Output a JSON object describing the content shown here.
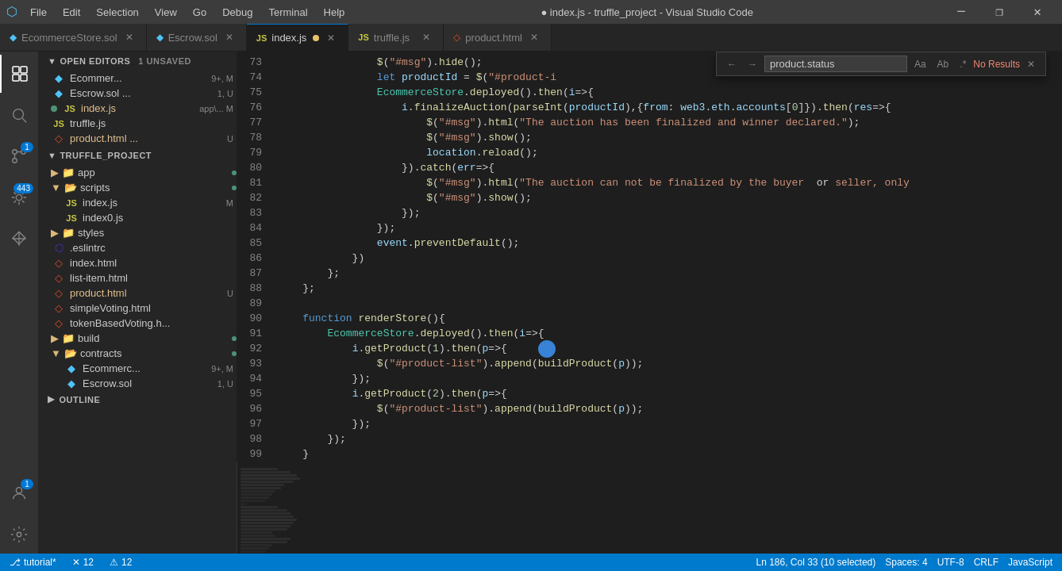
{
  "titleBar": {
    "icon": "⬡",
    "menuItems": [
      "File",
      "Edit",
      "Selection",
      "View",
      "Go",
      "Debug",
      "Terminal",
      "Help"
    ],
    "title": "● index.js - truffle_project - Visual Studio Code",
    "windowControls": {
      "minimize": "─",
      "maximize": "❐",
      "close": "✕"
    }
  },
  "tabs": [
    {
      "id": "ecommerce",
      "icon": "◆",
      "iconColor": "#4fc3f7",
      "label": "EcommerceStore.sol",
      "badge": "",
      "active": false,
      "modified": false
    },
    {
      "id": "escrow",
      "icon": "◆",
      "iconColor": "#4fc3f7",
      "label": "Escrow.sol",
      "badge": "",
      "active": false,
      "modified": false
    },
    {
      "id": "indexjs",
      "icon": "JS",
      "iconColor": "#cbcb41",
      "label": "index.js",
      "badge": "●",
      "active": true,
      "modified": true
    },
    {
      "id": "truffle",
      "icon": "JS",
      "iconColor": "#cbcb41",
      "label": "truffle.js",
      "badge": "",
      "active": false,
      "modified": false
    },
    {
      "id": "product",
      "icon": "◇",
      "iconColor": "#e34c26",
      "label": "product.html",
      "badge": "",
      "active": false,
      "modified": false
    }
  ],
  "searchWidget": {
    "placeholder": "product.status",
    "value": "product.status",
    "noResults": "No Results",
    "buttons": [
      "Aa",
      "Ab",
      ".*"
    ]
  },
  "activityBar": {
    "items": [
      {
        "id": "explorer",
        "icon": "⊞",
        "label": "Explorer",
        "active": true
      },
      {
        "id": "search",
        "icon": "🔍",
        "label": "Search",
        "active": false
      },
      {
        "id": "source-control",
        "icon": "⎇",
        "label": "Source Control",
        "badge": "1",
        "active": false
      },
      {
        "id": "debug",
        "icon": "▷",
        "label": "Debug",
        "badge": "443",
        "active": false
      },
      {
        "id": "extensions",
        "icon": "⊞",
        "label": "Extensions",
        "active": false
      }
    ],
    "bottomItems": [
      {
        "id": "accounts",
        "icon": "⚙",
        "label": "Accounts",
        "badge": "1"
      },
      {
        "id": "settings",
        "icon": "⚙",
        "label": "Settings"
      }
    ]
  },
  "sidebar": {
    "sections": [
      {
        "id": "open-editors",
        "label": "OPEN EDITORS",
        "badge": "1 UNSAVED",
        "items": [
          {
            "icon": "◆",
            "iconClass": "icon-sol",
            "label": "Ecommer...",
            "badge": "9+, M",
            "indent": 1
          },
          {
            "icon": "◆",
            "iconClass": "icon-sol",
            "label": "Escrow.sol ...",
            "badge": "1, U",
            "indent": 1
          },
          {
            "icon": "JS",
            "iconClass": "icon-js",
            "label": "index.js",
            "badge": "app\\... M",
            "modified": true,
            "dot": true,
            "indent": 1
          },
          {
            "icon": "JS",
            "iconClass": "icon-js",
            "label": "truffle.js",
            "badge": "",
            "indent": 1
          },
          {
            "icon": "◇",
            "iconClass": "icon-html",
            "label": "product.html ...",
            "badge": "U",
            "indent": 1
          }
        ]
      },
      {
        "id": "truffle-project",
        "label": "TRUFFLE_PROJECT",
        "items": [
          {
            "icon": "▶",
            "iconClass": "icon-folder",
            "label": "app",
            "dot": true,
            "indent": 1,
            "type": "folder-closed"
          },
          {
            "icon": "▼",
            "iconClass": "icon-folder-open",
            "label": "scripts",
            "dot": true,
            "indent": 1,
            "type": "folder-open"
          },
          {
            "icon": "JS",
            "iconClass": "icon-js",
            "label": "index.js",
            "badge": "M",
            "indent": 2
          },
          {
            "icon": "JS",
            "iconClass": "icon-js",
            "label": "index0.js",
            "indent": 2
          },
          {
            "icon": "▶",
            "iconClass": "icon-folder",
            "label": "styles",
            "indent": 1,
            "type": "folder-closed"
          },
          {
            "icon": "⬡",
            "iconClass": "icon-eslint",
            "label": ".eslintrc",
            "indent": 1
          },
          {
            "icon": "◇",
            "iconClass": "icon-html",
            "label": "index.html",
            "indent": 1
          },
          {
            "icon": "◇",
            "iconClass": "icon-html",
            "label": "list-item.html",
            "indent": 1
          },
          {
            "icon": "◇",
            "iconClass": "icon-html",
            "label": "product.html",
            "badge": "U",
            "modified": true,
            "indent": 1
          },
          {
            "icon": "◇",
            "iconClass": "icon-html",
            "label": "simpleVoting.html",
            "indent": 1
          },
          {
            "icon": "◇",
            "iconClass": "icon-html",
            "label": "tokenBasedVoting.h...",
            "indent": 1
          },
          {
            "icon": "▶",
            "iconClass": "icon-folder",
            "label": "build",
            "dot": true,
            "indent": 1,
            "type": "folder-closed"
          },
          {
            "icon": "▼",
            "iconClass": "icon-folder-open",
            "label": "contracts",
            "dot": true,
            "indent": 1,
            "type": "folder-open"
          },
          {
            "icon": "◆",
            "iconClass": "icon-sol",
            "label": "Ecommerc...",
            "badge": "9+, M",
            "indent": 2
          },
          {
            "icon": "◆",
            "iconClass": "icon-sol",
            "label": "Escrow.sol",
            "badge": "1, U",
            "indent": 2
          }
        ]
      },
      {
        "id": "outline",
        "label": "OUTLINE",
        "indent": 0
      }
    ]
  },
  "code": {
    "lines": [
      {
        "num": 73,
        "content": "                $(\"#msg\").hide();"
      },
      {
        "num": 74,
        "content": "                let productId = $(\"#product-i"
      },
      {
        "num": 75,
        "content": "                EcommerceStore.deployed().then(i=>{"
      },
      {
        "num": 76,
        "content": "                    i.finalizeAuction(parseInt(productId),{from: web3.eth.accounts[0]}).then(res=>{"
      },
      {
        "num": 77,
        "content": "                        $(\"#msg\").html(\"The auction has been finalized and winner declared.\");"
      },
      {
        "num": 78,
        "content": "                        $(\"#msg\").show();"
      },
      {
        "num": 79,
        "content": "                        location.reload();"
      },
      {
        "num": 80,
        "content": "                    }).catch(err=>{"
      },
      {
        "num": 81,
        "content": "                        $(\"#msg\").html(\"The auction can not be finalized by the buyer or seller, only"
      },
      {
        "num": 82,
        "content": "                        $(\"#msg\").show();"
      },
      {
        "num": 83,
        "content": "                    });"
      },
      {
        "num": 84,
        "content": "                });"
      },
      {
        "num": 85,
        "content": "                event.preventDefault();"
      },
      {
        "num": 86,
        "content": "            })"
      },
      {
        "num": 87,
        "content": "        };"
      },
      {
        "num": 88,
        "content": "    };"
      },
      {
        "num": 89,
        "content": ""
      },
      {
        "num": 90,
        "content": "    function renderStore(){"
      },
      {
        "num": 91,
        "content": "        EcommerceStore.deployed().then(i=>{"
      },
      {
        "num": 92,
        "content": "            i.getProduct(1).then(p=>{"
      },
      {
        "num": 93,
        "content": "                $(\"#product-list\").append(buildProduct(p));"
      },
      {
        "num": 94,
        "content": "            });"
      },
      {
        "num": 95,
        "content": "            i.getProduct(2).then(p=>{"
      },
      {
        "num": 96,
        "content": "                $(\"#product-list\").append(buildProduct(p));"
      },
      {
        "num": 97,
        "content": "            });"
      },
      {
        "num": 98,
        "content": "        });"
      },
      {
        "num": 99,
        "content": "    }"
      }
    ]
  },
  "statusBar": {
    "left": [
      {
        "id": "branch",
        "icon": "⎇",
        "text": "tutorial*"
      },
      {
        "id": "errors",
        "icon": "✕",
        "text": "12"
      },
      {
        "id": "warnings",
        "icon": "⚠",
        "text": "12"
      }
    ],
    "right": [
      {
        "id": "cursor",
        "text": "Ln 186, Col 33 (10 selected)"
      },
      {
        "id": "spaces",
        "text": "Spaces: 4"
      },
      {
        "id": "encoding",
        "text": "UTF-8"
      },
      {
        "id": "eol",
        "text": "CRLF"
      },
      {
        "id": "language",
        "text": "JavaScript"
      }
    ]
  }
}
